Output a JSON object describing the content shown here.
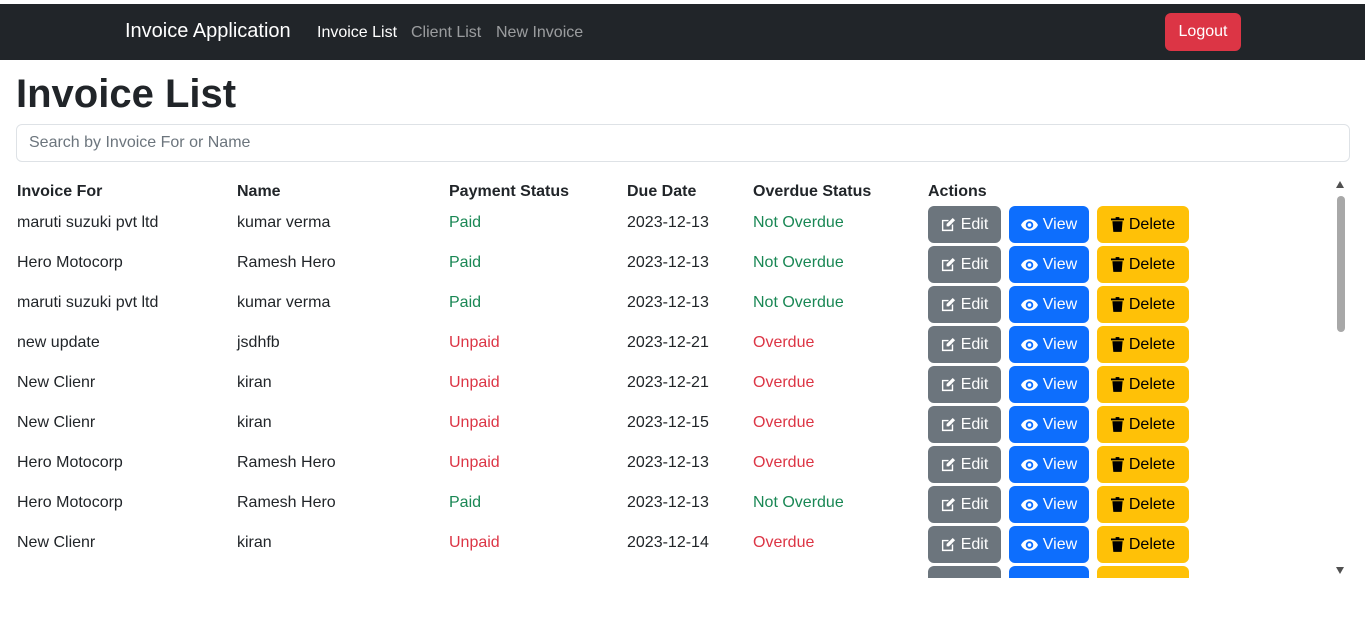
{
  "navbar": {
    "brand": "Invoice Application",
    "links": [
      "Invoice List",
      "Client List",
      "New Invoice"
    ],
    "logout_label": "Logout"
  },
  "page": {
    "title": "Invoice List",
    "search_placeholder": "Search by Invoice For or Name"
  },
  "table": {
    "headers": [
      "Invoice For",
      "Name",
      "Payment Status",
      "Due Date",
      "Overdue Status",
      "Actions"
    ],
    "rows": [
      {
        "invoice_for": "maruti suzuki pvt ltd",
        "name": "kumar verma",
        "payment_status": "Paid",
        "due_date": "2023-12-13",
        "overdue_status": "Not Overdue"
      },
      {
        "invoice_for": "Hero Motocorp",
        "name": "Ramesh Hero",
        "payment_status": "Paid",
        "due_date": "2023-12-13",
        "overdue_status": "Not Overdue"
      },
      {
        "invoice_for": "maruti suzuki pvt ltd",
        "name": "kumar verma",
        "payment_status": "Paid",
        "due_date": "2023-12-13",
        "overdue_status": "Not Overdue"
      },
      {
        "invoice_for": "new update",
        "name": "jsdhfb",
        "payment_status": "Unpaid",
        "due_date": "2023-12-21",
        "overdue_status": "Overdue"
      },
      {
        "invoice_for": "New Clienr",
        "name": "kiran",
        "payment_status": "Unpaid",
        "due_date": "2023-12-21",
        "overdue_status": "Overdue"
      },
      {
        "invoice_for": "New Clienr",
        "name": "kiran",
        "payment_status": "Unpaid",
        "due_date": "2023-12-15",
        "overdue_status": "Overdue"
      },
      {
        "invoice_for": "Hero Motocorp",
        "name": "Ramesh Hero",
        "payment_status": "Unpaid",
        "due_date": "2023-12-13",
        "overdue_status": "Overdue"
      },
      {
        "invoice_for": "Hero Motocorp",
        "name": "Ramesh Hero",
        "payment_status": "Paid",
        "due_date": "2023-12-13",
        "overdue_status": "Not Overdue"
      },
      {
        "invoice_for": "New Clienr",
        "name": "kiran",
        "payment_status": "Unpaid",
        "due_date": "2023-12-14",
        "overdue_status": "Overdue"
      }
    ],
    "actions": {
      "edit": "Edit",
      "view": "View",
      "delete": "Delete"
    }
  },
  "colors": {
    "navbar_bg": "#212529",
    "logout": "#dc3545",
    "paid": "#198754",
    "unpaid": "#dc3545",
    "edit": "#6c757d",
    "view": "#0d6efd",
    "delete": "#ffc107"
  },
  "icons": {
    "edit": "edit-icon",
    "view": "eye-icon",
    "delete": "trash-icon"
  }
}
